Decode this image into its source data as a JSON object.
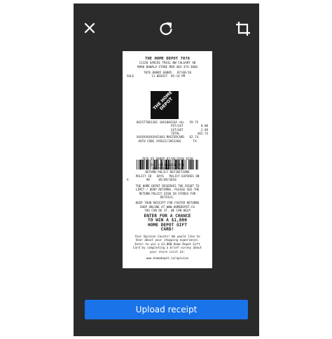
{
  "toolbar": {
    "close_icon": "close-icon",
    "rotate_icon": "rotate-icon",
    "crop_icon": "crop-icon"
  },
  "receipt": {
    "header": "THE HOME DEPOT 7076",
    "address_1": "11320 SARCEE TRAIL NW CALGARY AB",
    "address_2": "MARK BAWALA STORE MGR 403-374-3860",
    "txn_line": "7076 00005 60805   07/06/10",
    "sale_line": "SALE          11 WGS927  05:14 PM",
    "logo_text": "THE HOME DEPOT",
    "item_line": "062577061301 10X100CGSA <A>   59.75",
    "subtotal_label": "PST/GST          0.00",
    "gst_line": "GST/HST          2.99",
    "total_line": "TOTAL          $62.74",
    "payment_line": "XXXXXXXXXXXX2403 MASTERCARD   62.74",
    "auth_line": "AUTH CODE 195622/2053268       TA",
    "barcode_caption": "7076 05 60805 07/06/2010 0150",
    "policy_1": "5L  1ST 01301172911",
    "policy_2": "ON PROVINCIAL TAX",
    "policy_3": "RETURN POLICY DEFINITIONS",
    "policy_4": "POLICY ID   DAYS   POLICY EXPIRES ON",
    "policy_5": "A          90     05/09/2010",
    "notice_1": "THE HOME DEPOT RESERVES THE RIGHT TO",
    "notice_2": "LIMIT / DENY RETURNS. PLEASE SEE THE",
    "notice_3": "RETURN POLICY SIGN IN STORES FOR",
    "notice_4": "DETAILS.",
    "keep_1": "KEEP YOUR RECEIPT FOR FASTER RETURNS",
    "keep_2": "SHOP ONLINE AT WWW.HOMEDEPOT.CA",
    "keep_3": "YOU CAN DO IT. WE CAN HELP",
    "contest_1": "ENTER FOR A CHANCE",
    "contest_2": "TO WIN A $1,000",
    "contest_3": "HOME DEPOT GIFT",
    "contest_4": "CARD!",
    "survey_1": "Your Opinion Counts! We would like to",
    "survey_2": "hear about your shopping experience.",
    "survey_3": "Enter to win a $1,000 Home Depot Gift",
    "survey_4": "Card by completing a brief survey about",
    "survey_5": "your store visit at:",
    "survey_url": "www.homedepot.ca/opinion"
  },
  "actions": {
    "upload_label": "Upload receipt"
  },
  "colors": {
    "background": "#2b2b2b",
    "button": "#1a73e8"
  }
}
